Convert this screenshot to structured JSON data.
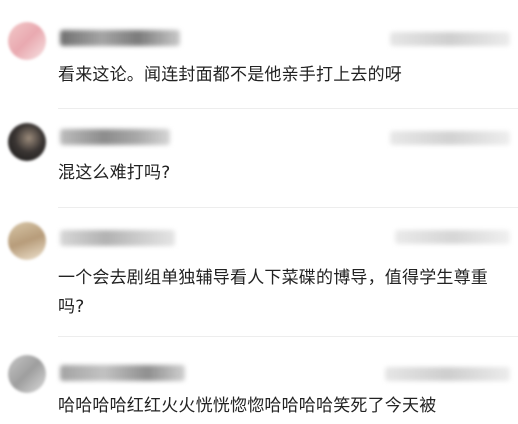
{
  "comments": [
    {
      "text": "看来这论。闻连封面都不是他亲手打上去的呀"
    },
    {
      "text": "混这么难打吗?"
    },
    {
      "text": "一个会去剧组单独辅导看人下菜碟的博导，值得学生尊重吗?"
    },
    {
      "text": "哈哈哈哈红红火火恍恍惚惚哈哈哈哈笑死了今天被"
    }
  ]
}
